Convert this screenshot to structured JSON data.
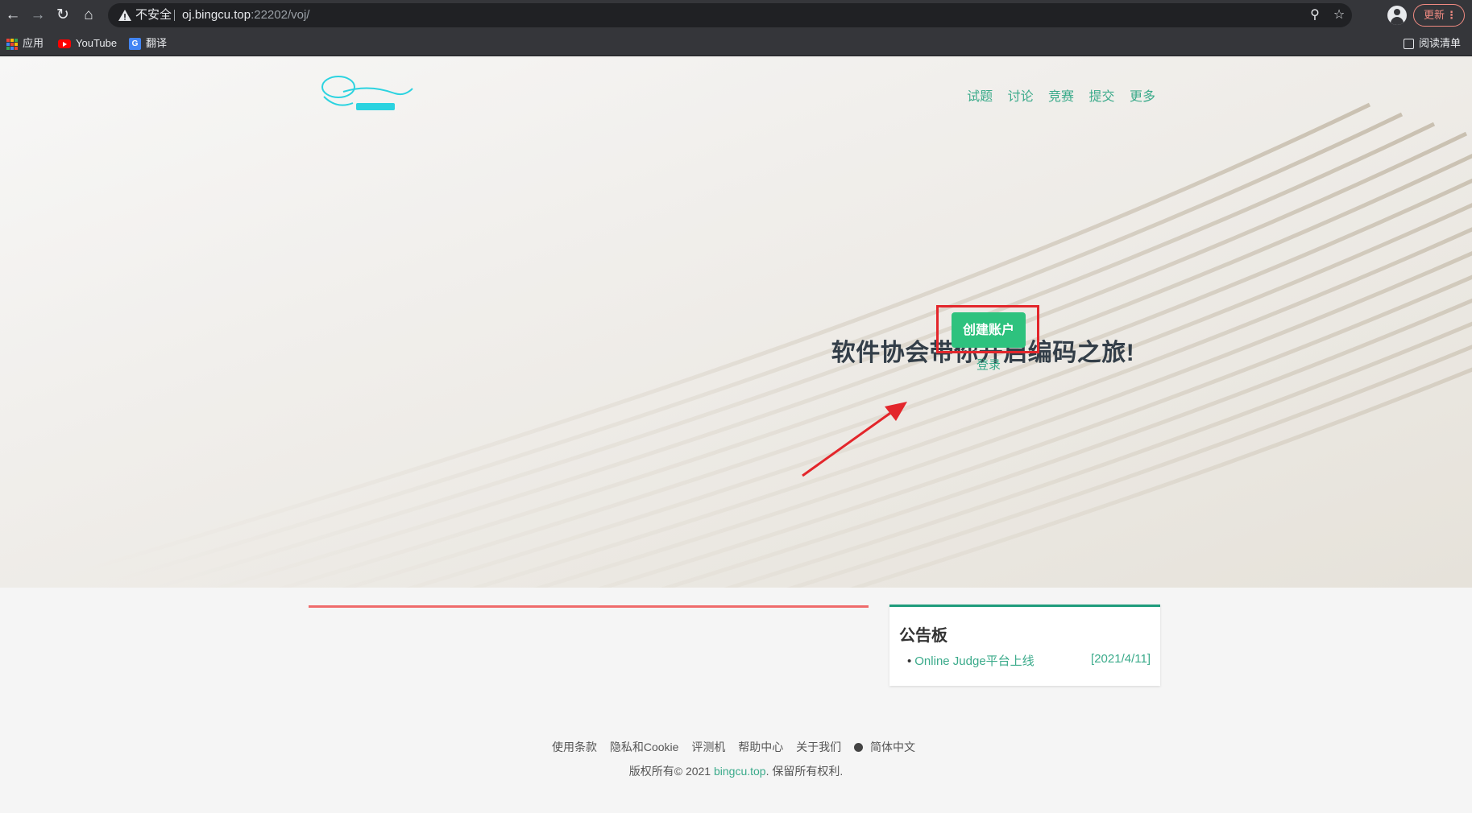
{
  "browser": {
    "security_label": "不安全",
    "url_host": "oj.bingcu.top",
    "url_rest": ":22202/voj/",
    "update_label": "更新",
    "icons": [
      "back-icon",
      "forward-icon",
      "reload-icon",
      "home-icon",
      "warning-icon",
      "zoom-icon",
      "star-icon",
      "profile-icon",
      "more-icon"
    ]
  },
  "bookmarks": {
    "apps": "应用",
    "youtube": "YouTube",
    "translate": "翻译",
    "reading_list": "阅读清单"
  },
  "nav": {
    "items": [
      "试题",
      "讨论",
      "竞赛",
      "提交",
      "更多"
    ]
  },
  "hero": {
    "headline": "软件协会带你开启编码之旅!",
    "cta": "创建账户",
    "login": "登录"
  },
  "board": {
    "title": "公告板",
    "items": [
      {
        "title": "Online Judge平台上线",
        "date": "[2021/4/11]"
      }
    ]
  },
  "footer": {
    "links": [
      "使用条款",
      "隐私和Cookie",
      "评测机",
      "帮助中心",
      "关于我们",
      "简体中文"
    ],
    "copyright_prefix": "版权所有© 2021 ",
    "copyright_site": "bingcu.top",
    "copyright_suffix": ". 保留所有权利."
  },
  "colors": {
    "accent": "#3aaa8a",
    "cta": "#2ec27e",
    "highlight": "#e3262b",
    "board_border": "#1f9c7c"
  }
}
